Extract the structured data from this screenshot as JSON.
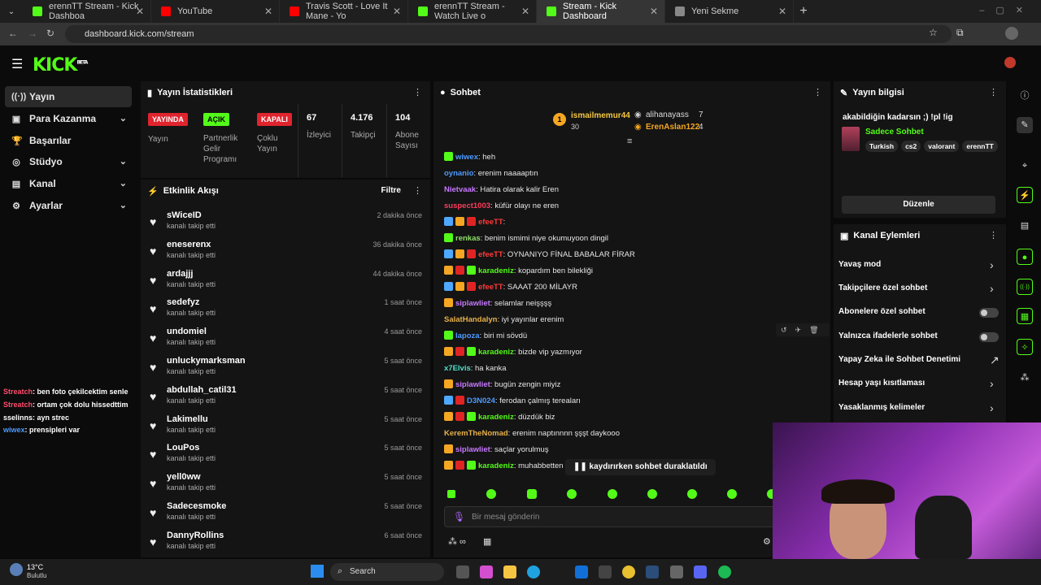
{
  "browser": {
    "tabs": [
      {
        "title": "erennTT Stream - Kick Dashboa",
        "favcolor": "#53fc18"
      },
      {
        "title": "YouTube",
        "favcolor": "#ff0000"
      },
      {
        "title": "Travis Scott - Love It Mane - Yo",
        "favcolor": "#ff0000"
      },
      {
        "title": "erennTT Stream - Watch Live o",
        "favcolor": "#53fc18"
      },
      {
        "title": "Stream - Kick Dashboard",
        "favcolor": "#53fc18"
      },
      {
        "title": "Yeni Sekme",
        "favcolor": "#888888"
      }
    ],
    "url": "dashboard.kick.com/stream"
  },
  "kick": {
    "logo": "KICK",
    "beta": "BETA"
  },
  "nav": [
    {
      "label": "Yayın",
      "icon": "((·))"
    },
    {
      "label": "Para Kazanma",
      "icon": "▣"
    },
    {
      "label": "Başarılar",
      "icon": "🏆"
    },
    {
      "label": "Stüdyo",
      "icon": "◎"
    },
    {
      "label": "Kanal",
      "icon": "▤"
    },
    {
      "label": "Ayarlar",
      "icon": "⚙"
    }
  ],
  "overlay_chat": [
    {
      "user": "Streatch",
      "text": ": ben foto çekilcektim senle"
    },
    {
      "user": "Streatch",
      "text": ": ortam çok dolu hissedttim"
    },
    {
      "user": "sselinns",
      "text": ": ayn strec"
    },
    {
      "user": "wiwex",
      "text": ": prensipleri var"
    }
  ],
  "stats": {
    "title": "Yayın İstatistikleri",
    "live_badge": "YAYINDA",
    "live_label": "Yayın",
    "partner_badge": "AÇIK",
    "partner_label": "Partnerlik Gelir Programı",
    "multi_badge": "KAPALI",
    "multi_label": "Çoklu Yayın",
    "viewers": "67",
    "viewers_label": "İzleyici",
    "followers": "4.176",
    "followers_label": "Takipçi",
    "subs": "104",
    "subs_label": "Abone Sayısı"
  },
  "activity": {
    "title": "Etkinlik Akışı",
    "filter": "Filtre",
    "sub": "kanalı takip etti",
    "items": [
      {
        "name": "sWiceID",
        "time": "2 dakika önce"
      },
      {
        "name": "eneserenx",
        "time": "36 dakika önce"
      },
      {
        "name": "ardajjj",
        "time": "44 dakika önce"
      },
      {
        "name": "sedefyz",
        "time": "1 saat önce"
      },
      {
        "name": "undomiel",
        "time": "4 saat önce"
      },
      {
        "name": "unluckymarksman",
        "time": "5 saat önce"
      },
      {
        "name": "abdullah_catil31",
        "time": "5 saat önce"
      },
      {
        "name": "Lakimellu",
        "time": "5 saat önce"
      },
      {
        "name": "LouPos",
        "time": "5 saat önce"
      },
      {
        "name": "yell0ww",
        "time": "5 saat önce"
      },
      {
        "name": "Sadecesmoke",
        "time": "5 saat önce"
      },
      {
        "name": "DannyRollins",
        "time": "6 saat önce"
      }
    ]
  },
  "chat": {
    "title": "Sohbet",
    "top": [
      {
        "rank": "1",
        "name": "ismailmemur44",
        "count": "30"
      },
      {
        "rank": "",
        "name": "alihanayass",
        "count": "7"
      },
      {
        "rank": "",
        "name": "ErenAslan122",
        "count": "4"
      }
    ],
    "messages": [
      {
        "user": "wiwex",
        "text": ": heh",
        "color": "#4d9bff",
        "badges": [
          "#53fc18"
        ]
      },
      {
        "user": "oynanio",
        "text": ": erenim naaaaptın",
        "color": "#4d9bff",
        "badges": []
      },
      {
        "user": "Nietvaak",
        "text": ": Hatira olarak kalir Eren",
        "color": "#c678ff",
        "badges": []
      },
      {
        "user": "suspect1003",
        "text": ": küfür olayı ne eren",
        "color": "#ff3b5c",
        "badges": []
      },
      {
        "user": "efeeTT",
        "text": ":",
        "color": "#ff3b3b",
        "badges": [
          "#4ea8ff",
          "#f5a623",
          "#e02424"
        ]
      },
      {
        "user": "renkas",
        "text": ": benim ismimi niye okumuyoon dingil",
        "color": "#8ee06b",
        "badges": [
          "#53fc18"
        ]
      },
      {
        "user": "efeeTT",
        "text": ": OYNANIYO FİNAL BABALAR FİRAR",
        "color": "#ff3b3b",
        "badges": [
          "#4ea8ff",
          "#f5a623",
          "#e02424"
        ]
      },
      {
        "user": "karadeniz",
        "text": ": kopardım ben bilekliği",
        "color": "#53fc18",
        "badges": [
          "#f5a623",
          "#e02424",
          "#53fc18"
        ]
      },
      {
        "user": "efeeTT",
        "text": ": SAAAT 200 MİLAYR",
        "color": "#ff3b3b",
        "badges": [
          "#4ea8ff",
          "#f5a623",
          "#e02424"
        ]
      },
      {
        "user": "siplawliet",
        "text": ": selamlar neişşşş",
        "color": "#c678ff",
        "badges": [
          "#f5a623"
        ]
      },
      {
        "user": "SalatHandalyn",
        "text": ": iyi yayınlar erenim",
        "color": "#e8b04a",
        "badges": []
      },
      {
        "user": "lapoza",
        "text": ": biri mi sövdü",
        "color": "#4d9bff",
        "badges": [
          "#53fc18"
        ]
      },
      {
        "user": "karadeniz",
        "text": ": bizde vip yazmıyor",
        "color": "#53fc18",
        "badges": [
          "#f5a623",
          "#e02424",
          "#53fc18"
        ]
      },
      {
        "user": "x7Elvis",
        "text": ": ha kanka",
        "color": "#4de0c8",
        "badges": []
      },
      {
        "user": "siplawliet",
        "text": ": bugün zengin miyiz",
        "color": "#c678ff",
        "badges": [
          "#f5a623"
        ]
      },
      {
        "user": "D3N024",
        "text": ": ferodan çalmış tereaları",
        "color": "#4d9bff",
        "badges": [
          "#4ea8ff",
          "#e02424"
        ]
      },
      {
        "user": "karadeniz",
        "text": ": düzdük biz",
        "color": "#53fc18",
        "badges": [
          "#f5a623",
          "#e02424",
          "#53fc18"
        ]
      },
      {
        "user": "KeremTheNomad",
        "text": ": erenim naptınnnn şşşt daykooo",
        "color": "#e8b04a",
        "badges": []
      },
      {
        "user": "siplawliet",
        "text": ": saçlar yorulmuş",
        "color": "#c678ff",
        "badges": [
          "#f5a623"
        ]
      },
      {
        "user": "karadeniz",
        "text": ": muhabbetten",
        "color": "#53fc18",
        "badges": [
          "#f5a623",
          "#e02424",
          "#53fc18"
        ]
      }
    ],
    "paused": "kaydırırken sohbet duraklatıldı",
    "placeholder": "Bir mesaj gönderin"
  },
  "stream_info": {
    "title": "Yayın bilgisi",
    "stream_title": "akabildiğin kadarsın ;) !pl !ig",
    "chat_mode": "Sadece Sohbet",
    "tags": [
      "Turkish",
      "cs2",
      "valorant",
      "erennTT"
    ],
    "edit": "Düzenle"
  },
  "channel_actions": {
    "title": "Kanal Eylemleri",
    "items": [
      {
        "label": "Yavaş mod",
        "ctrl": "chev"
      },
      {
        "label": "Takipçilere özel sohbet",
        "ctrl": "chev"
      },
      {
        "label": "Abonelere özel sohbet",
        "ctrl": "toggle"
      },
      {
        "label": "Yalnızca ifadelerle sohbet",
        "ctrl": "toggle"
      },
      {
        "label": "Yapay Zeka ile Sohbet Denetimi",
        "ctrl": "ext"
      },
      {
        "label": "Hesap yaşı kısıtlaması",
        "ctrl": "chev"
      },
      {
        "label": "Yasaklanmış kelimeler",
        "ctrl": "chev"
      }
    ]
  },
  "taskbar": {
    "weather_temp": "13°C",
    "weather_desc": "Bulutlu",
    "search": "Search"
  }
}
